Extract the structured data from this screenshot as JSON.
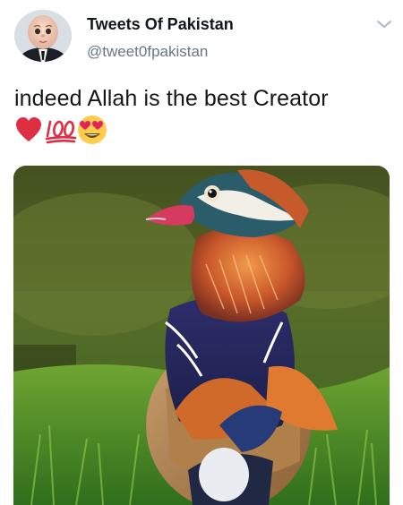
{
  "tweet": {
    "display_name": "Tweets Of Pakistan",
    "handle": "@tweet0fpakistan",
    "text": "indeed Allah is the best Creator",
    "emojis": [
      "red-heart-emoji",
      "hundred-points-emoji",
      "heart-eyes-emoji"
    ]
  },
  "media": {
    "type": "photo",
    "icon": "photo-mandarin-duck"
  },
  "colors": {
    "name": "#14171a",
    "handle": "#657786",
    "chevron": "#aab8c2",
    "heart": "#dd2e44",
    "hundred": "#dd2e44",
    "emoji_face": "#ffcc4d"
  }
}
